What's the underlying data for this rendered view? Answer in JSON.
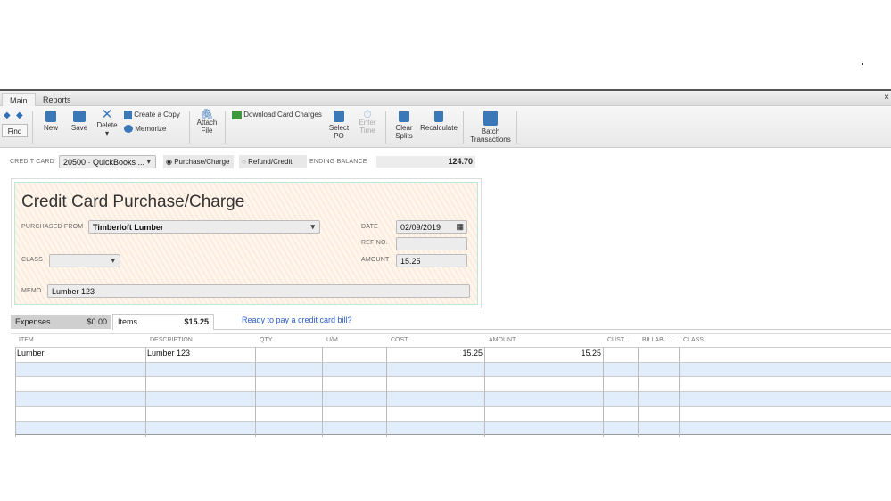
{
  "tabs": [
    "Main",
    "Reports"
  ],
  "toolbar": {
    "find": "Find",
    "new": "New",
    "save": "Save",
    "delete": "Delete",
    "create_copy": "Create a Copy",
    "memorize": "Memorize",
    "attach": [
      "Attach",
      "File"
    ],
    "download": "Download Card Charges",
    "select_po": [
      "Select",
      "PO"
    ],
    "enter_time": [
      "Enter",
      "Time"
    ],
    "clear_splits": [
      "Clear",
      "Splits"
    ],
    "recalculate": "Recalculate",
    "batch": [
      "Batch",
      "Transactions"
    ]
  },
  "header": {
    "credit_card_label": "CREDIT CARD",
    "credit_card_value": "20500 · QuickBooks ...",
    "purchase_charge": "Purchase/Charge",
    "refund_credit": "Refund/Credit",
    "ending_balance_label": "ENDING BALANCE",
    "ending_balance": "124.70"
  },
  "form": {
    "title": "Credit Card Purchase/Charge",
    "purchased_from_label": "PURCHASED FROM",
    "purchased_from": "Timberloft Lumber",
    "date_label": "DATE",
    "date": "02/09/2019",
    "ref_label": "REF NO.",
    "ref": "",
    "class_label": "CLASS",
    "class": "",
    "amount_label": "AMOUNT",
    "amount": "15.25",
    "memo_label": "MEMO",
    "memo": "Lumber 123"
  },
  "detail_tabs": {
    "expenses": "Expenses",
    "expenses_total": "$0.00",
    "items": "Items",
    "items_total": "$15.25",
    "link": "Ready to pay a credit card bill?"
  },
  "table": {
    "columns": [
      "ITEM",
      "DESCRIPTION",
      "QTY",
      "U/M",
      "COST",
      "AMOUNT",
      "CUST...",
      "BILLABL...",
      "CLASS"
    ],
    "rows": [
      {
        "item": "Lumber",
        "description": "Lumber 123",
        "qty": "",
        "um": "",
        "cost": "15.25",
        "amount": "15.25"
      }
    ]
  }
}
